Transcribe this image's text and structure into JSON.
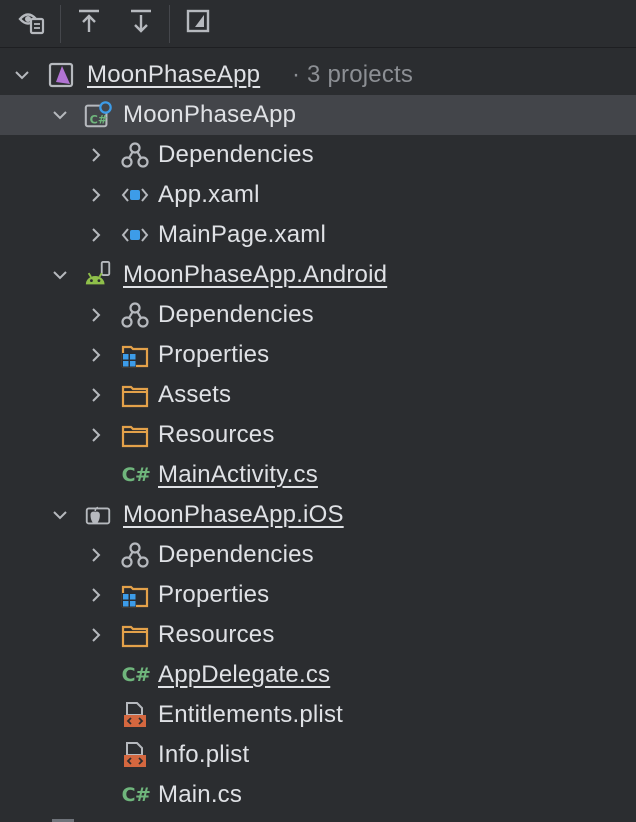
{
  "toolbar": {
    "buttons": [
      {
        "name": "view-options",
        "icon": "eye-file-icon"
      },
      {
        "name": "collapse-all",
        "icon": "arrow-up-to-line-icon"
      },
      {
        "name": "expand-all",
        "icon": "arrow-down-to-line-icon"
      },
      {
        "name": "preview",
        "icon": "preview-pane-icon"
      }
    ]
  },
  "tree": {
    "solution": {
      "label": "MoonPhaseApp",
      "suffix": "· 3 projects",
      "icon": "solution-icon"
    },
    "shared": {
      "label": "MoonPhaseApp",
      "icon": "csharp-project-icon",
      "children": [
        {
          "label": "Dependencies",
          "icon": "dependencies-icon"
        },
        {
          "label": "App.xaml",
          "icon": "xaml-icon"
        },
        {
          "label": "MainPage.xaml",
          "icon": "xaml-icon"
        }
      ]
    },
    "android": {
      "label": "MoonPhaseApp.Android",
      "icon": "android-project-icon",
      "children": [
        {
          "label": "Dependencies",
          "icon": "dependencies-icon"
        },
        {
          "label": "Properties",
          "icon": "properties-folder-icon"
        },
        {
          "label": "Assets",
          "icon": "folder-icon"
        },
        {
          "label": "Resources",
          "icon": "folder-icon"
        },
        {
          "label": "MainActivity.cs",
          "icon": "csharp-file-icon"
        }
      ]
    },
    "ios": {
      "label": "MoonPhaseApp.iOS",
      "icon": "ios-project-icon",
      "children": [
        {
          "label": "Dependencies",
          "icon": "dependencies-icon"
        },
        {
          "label": "Properties",
          "icon": "properties-folder-icon"
        },
        {
          "label": "Resources",
          "icon": "folder-icon"
        },
        {
          "label": "AppDelegate.cs",
          "icon": "csharp-file-icon"
        },
        {
          "label": "Entitlements.plist",
          "icon": "plist-icon"
        },
        {
          "label": "Info.plist",
          "icon": "plist-icon"
        },
        {
          "label": "Main.cs",
          "icon": "csharp-file-icon"
        }
      ]
    }
  },
  "icon_text": {
    "csharp": "C#"
  },
  "colors": {
    "background": "#2b2d30",
    "selection": "#43454a",
    "text": "#dfe1e5",
    "muted": "#8c8f94",
    "folder": "#e3a14a",
    "xaml": "#3d9ce8",
    "csharp": "#6fb57c",
    "android": "#8fbf4a",
    "plist": "#d4673f"
  }
}
